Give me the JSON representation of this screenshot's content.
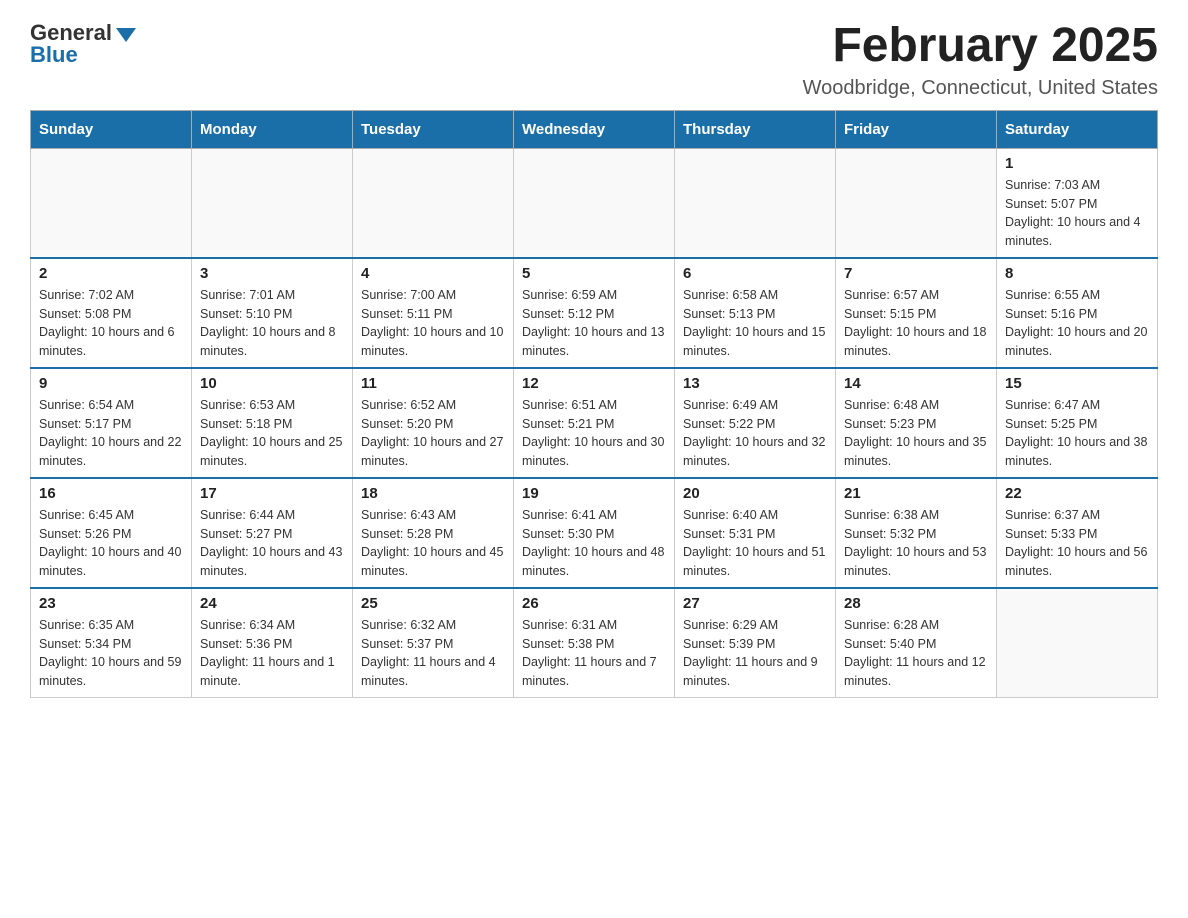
{
  "logo": {
    "general": "General",
    "blue": "Blue"
  },
  "header": {
    "month_year": "February 2025",
    "location": "Woodbridge, Connecticut, United States"
  },
  "days_of_week": [
    "Sunday",
    "Monday",
    "Tuesday",
    "Wednesday",
    "Thursday",
    "Friday",
    "Saturday"
  ],
  "weeks": [
    [
      {
        "day": "",
        "info": ""
      },
      {
        "day": "",
        "info": ""
      },
      {
        "day": "",
        "info": ""
      },
      {
        "day": "",
        "info": ""
      },
      {
        "day": "",
        "info": ""
      },
      {
        "day": "",
        "info": ""
      },
      {
        "day": "1",
        "info": "Sunrise: 7:03 AM\nSunset: 5:07 PM\nDaylight: 10 hours and 4 minutes."
      }
    ],
    [
      {
        "day": "2",
        "info": "Sunrise: 7:02 AM\nSunset: 5:08 PM\nDaylight: 10 hours and 6 minutes."
      },
      {
        "day": "3",
        "info": "Sunrise: 7:01 AM\nSunset: 5:10 PM\nDaylight: 10 hours and 8 minutes."
      },
      {
        "day": "4",
        "info": "Sunrise: 7:00 AM\nSunset: 5:11 PM\nDaylight: 10 hours and 10 minutes."
      },
      {
        "day": "5",
        "info": "Sunrise: 6:59 AM\nSunset: 5:12 PM\nDaylight: 10 hours and 13 minutes."
      },
      {
        "day": "6",
        "info": "Sunrise: 6:58 AM\nSunset: 5:13 PM\nDaylight: 10 hours and 15 minutes."
      },
      {
        "day": "7",
        "info": "Sunrise: 6:57 AM\nSunset: 5:15 PM\nDaylight: 10 hours and 18 minutes."
      },
      {
        "day": "8",
        "info": "Sunrise: 6:55 AM\nSunset: 5:16 PM\nDaylight: 10 hours and 20 minutes."
      }
    ],
    [
      {
        "day": "9",
        "info": "Sunrise: 6:54 AM\nSunset: 5:17 PM\nDaylight: 10 hours and 22 minutes."
      },
      {
        "day": "10",
        "info": "Sunrise: 6:53 AM\nSunset: 5:18 PM\nDaylight: 10 hours and 25 minutes."
      },
      {
        "day": "11",
        "info": "Sunrise: 6:52 AM\nSunset: 5:20 PM\nDaylight: 10 hours and 27 minutes."
      },
      {
        "day": "12",
        "info": "Sunrise: 6:51 AM\nSunset: 5:21 PM\nDaylight: 10 hours and 30 minutes."
      },
      {
        "day": "13",
        "info": "Sunrise: 6:49 AM\nSunset: 5:22 PM\nDaylight: 10 hours and 32 minutes."
      },
      {
        "day": "14",
        "info": "Sunrise: 6:48 AM\nSunset: 5:23 PM\nDaylight: 10 hours and 35 minutes."
      },
      {
        "day": "15",
        "info": "Sunrise: 6:47 AM\nSunset: 5:25 PM\nDaylight: 10 hours and 38 minutes."
      }
    ],
    [
      {
        "day": "16",
        "info": "Sunrise: 6:45 AM\nSunset: 5:26 PM\nDaylight: 10 hours and 40 minutes."
      },
      {
        "day": "17",
        "info": "Sunrise: 6:44 AM\nSunset: 5:27 PM\nDaylight: 10 hours and 43 minutes."
      },
      {
        "day": "18",
        "info": "Sunrise: 6:43 AM\nSunset: 5:28 PM\nDaylight: 10 hours and 45 minutes."
      },
      {
        "day": "19",
        "info": "Sunrise: 6:41 AM\nSunset: 5:30 PM\nDaylight: 10 hours and 48 minutes."
      },
      {
        "day": "20",
        "info": "Sunrise: 6:40 AM\nSunset: 5:31 PM\nDaylight: 10 hours and 51 minutes."
      },
      {
        "day": "21",
        "info": "Sunrise: 6:38 AM\nSunset: 5:32 PM\nDaylight: 10 hours and 53 minutes."
      },
      {
        "day": "22",
        "info": "Sunrise: 6:37 AM\nSunset: 5:33 PM\nDaylight: 10 hours and 56 minutes."
      }
    ],
    [
      {
        "day": "23",
        "info": "Sunrise: 6:35 AM\nSunset: 5:34 PM\nDaylight: 10 hours and 59 minutes."
      },
      {
        "day": "24",
        "info": "Sunrise: 6:34 AM\nSunset: 5:36 PM\nDaylight: 11 hours and 1 minute."
      },
      {
        "day": "25",
        "info": "Sunrise: 6:32 AM\nSunset: 5:37 PM\nDaylight: 11 hours and 4 minutes."
      },
      {
        "day": "26",
        "info": "Sunrise: 6:31 AM\nSunset: 5:38 PM\nDaylight: 11 hours and 7 minutes."
      },
      {
        "day": "27",
        "info": "Sunrise: 6:29 AM\nSunset: 5:39 PM\nDaylight: 11 hours and 9 minutes."
      },
      {
        "day": "28",
        "info": "Sunrise: 6:28 AM\nSunset: 5:40 PM\nDaylight: 11 hours and 12 minutes."
      },
      {
        "day": "",
        "info": ""
      }
    ]
  ]
}
